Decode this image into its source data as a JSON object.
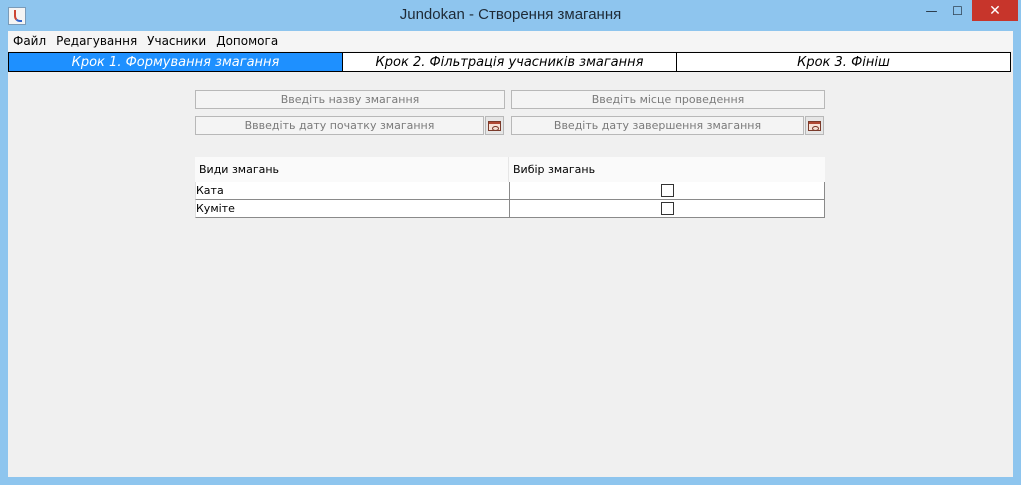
{
  "window": {
    "title": "Jundokan - Створення змагання",
    "icon": "java-cup-icon",
    "controls": {
      "minimize": "—",
      "maximize": "☐",
      "close": "✕"
    }
  },
  "menubar": {
    "items": [
      "Файл",
      "Редагування",
      "Учасники",
      "Допомога"
    ]
  },
  "tabs": [
    {
      "label": "Крок 1. Формування змагання",
      "active": true
    },
    {
      "label": "Крок 2. Фільтрація учасників змагання",
      "active": false
    },
    {
      "label": "Крок 3. Фініш",
      "active": false
    }
  ],
  "form": {
    "name_placeholder": "Введіть назву змагання",
    "place_placeholder": "Введіть місце проведення",
    "start_date_placeholder": "Ввведіть дату початку змагання",
    "end_date_placeholder": "Введіть дату завершення змагання",
    "calendar_icon": "calendar-icon"
  },
  "table": {
    "headers": [
      "Види змагань",
      "Вибір змагань"
    ],
    "rows": [
      {
        "name": "Ката",
        "checked": false
      },
      {
        "name": "Куміте",
        "checked": false
      }
    ]
  },
  "colors": {
    "active_tab": "#1e90ff",
    "frame": "#8ec5ee",
    "close_button": "#c7352b"
  }
}
